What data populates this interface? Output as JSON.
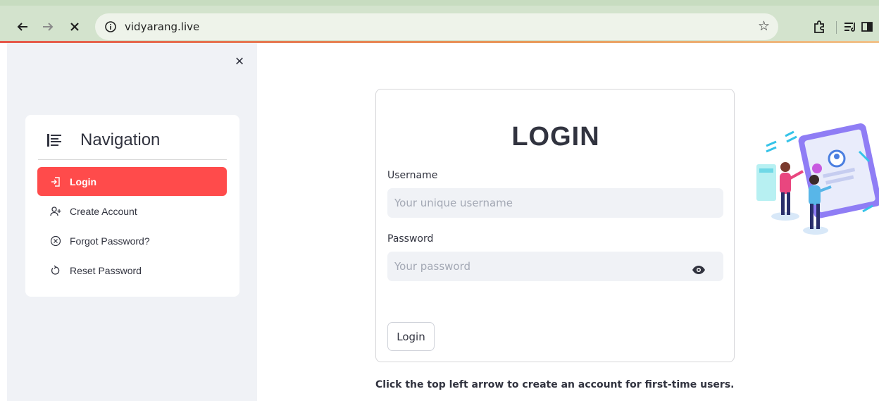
{
  "browser": {
    "url": "vidyarang.live",
    "icons": [
      "back-arrow-icon",
      "forward-arrow-icon",
      "stop-icon",
      "site-info-icon",
      "bookmark-star-icon",
      "extensions-icon",
      "reading-list-icon",
      "side-panel-icon"
    ]
  },
  "sidebar": {
    "close_icon": "close-icon",
    "nav_title": "Navigation",
    "items": [
      {
        "label": "Login",
        "icon": "login-enter-icon",
        "active": true
      },
      {
        "label": "Create Account",
        "icon": "person-add-icon",
        "active": false
      },
      {
        "label": "Forgot Password?",
        "icon": "circle-x-icon",
        "active": false
      },
      {
        "label": "Reset Password",
        "icon": "reload-icon",
        "active": false
      }
    ]
  },
  "login": {
    "title": "LOGIN",
    "username_label": "Username",
    "username_placeholder": "Your unique username",
    "username_value": "",
    "password_label": "Password",
    "password_placeholder": "Your password",
    "password_value": "",
    "submit_label": "Login"
  },
  "hint": "Click the top left arrow to create an account for first-time users.",
  "colors": {
    "accent": "#ff4b4b",
    "sidebar_bg": "#f0f2f6",
    "text": "#31333f",
    "input_bg": "#f0f2f6"
  }
}
